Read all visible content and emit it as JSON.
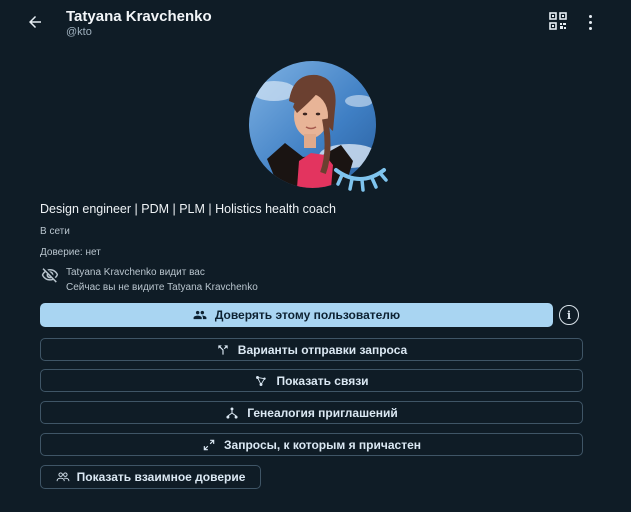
{
  "header": {
    "title": "Tatyana Kravchenko",
    "handle": "@kto"
  },
  "profile": {
    "bio": "Design engineer | PDM | PLM | Holistics health coach",
    "status": "В сети",
    "trust": "Доверие: нет",
    "visibility_line1": "Tatyana Kravchenko видит вас",
    "visibility_line2": "Сейчас вы не видите Tatyana Kravchenko"
  },
  "actions": {
    "trust_user": "Доверять этому пользователю",
    "request_options": "Варианты отправки запроса",
    "show_connections": "Показать связи",
    "invite_genealogy": "Генеалогия приглашений",
    "my_requests": "Запросы, к которым я причастен",
    "mutual_trust": "Показать взаимное доверие"
  },
  "colors": {
    "background": "#0f1c26",
    "primary_button": "#a9d5f2",
    "eyelash_accent": "#7fc4ee"
  }
}
